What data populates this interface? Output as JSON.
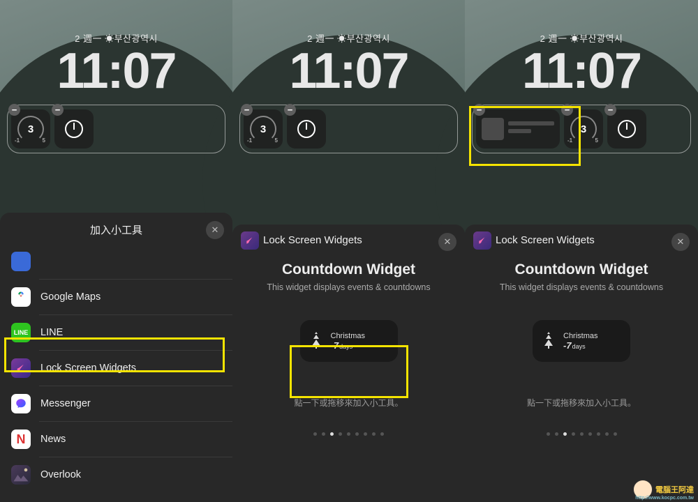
{
  "dateline": "2 週一 ☀부산광역시",
  "clock": "11:07",
  "gauge_value": "3",
  "sheet1": {
    "title": "加入小工具",
    "apps": [
      {
        "name": "",
        "icon": "blank"
      },
      {
        "name": "Google Maps",
        "icon": "gmaps"
      },
      {
        "name": "LINE",
        "icon": "line"
      },
      {
        "name": "Lock Screen Widgets",
        "icon": "lsw"
      },
      {
        "name": "Messenger",
        "icon": "msngr"
      },
      {
        "name": "News",
        "icon": "news"
      },
      {
        "name": "Overlook",
        "icon": "ovl"
      }
    ]
  },
  "sheet2": {
    "back_label": "Lock Screen Widgets",
    "title": "Countdown Widget",
    "desc": "This widget displays events & countdowns",
    "preview_name": "Christmas",
    "preview_count": "-7",
    "preview_unit": "days",
    "hint": "點一下或拖移來加入小工具。"
  },
  "watermark": {
    "text": "電腦王阿達",
    "url": "http://www.kocpc.com.tw"
  }
}
